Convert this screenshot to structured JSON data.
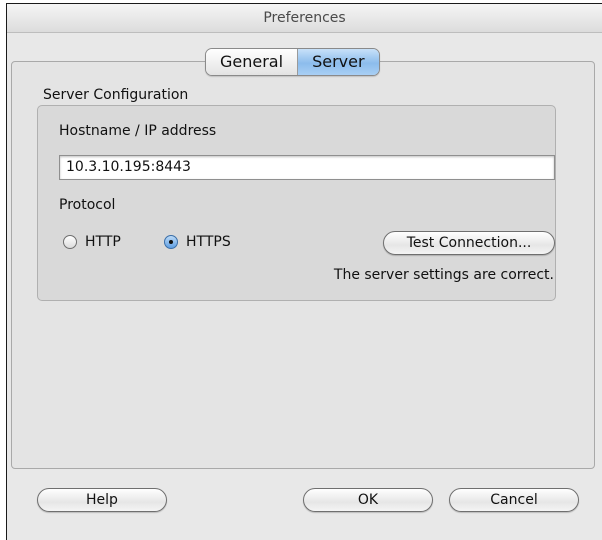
{
  "window": {
    "title": "Preferences"
  },
  "tabs": [
    {
      "label": "General",
      "selected": false
    },
    {
      "label": "Server",
      "selected": true
    }
  ],
  "server_config": {
    "group_label": "Server Configuration",
    "hostname_label": "Hostname / IP address",
    "hostname_value": "10.3.10.195:8443",
    "protocol_label": "Protocol",
    "protocol_options": [
      {
        "label": "HTTP",
        "checked": false
      },
      {
        "label": "HTTPS",
        "checked": true
      }
    ],
    "test_button_label": "Test Connection...",
    "status_message": "The server settings are correct."
  },
  "footer": {
    "help_label": "Help",
    "ok_label": "OK",
    "cancel_label": "Cancel"
  },
  "colors": {
    "selected_tab": "#8cbcec",
    "window_background": "#e8e8e8"
  }
}
